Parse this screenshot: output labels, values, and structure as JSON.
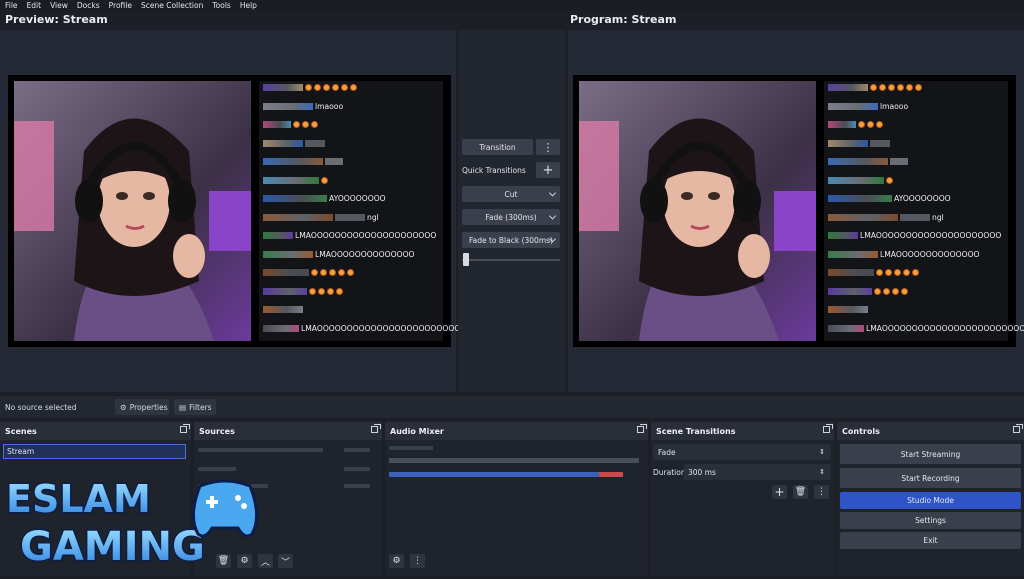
{
  "menu": [
    "File",
    "Edit",
    "View",
    "Docks",
    "Profile",
    "Scene Collection",
    "Tools",
    "Help"
  ],
  "preview": {
    "title": "Preview: Stream"
  },
  "program": {
    "title": "Program: Stream"
  },
  "chat": {
    "lines": [
      {
        "text": "",
        "emojis": 6
      },
      {
        "text": "lmaooo",
        "emojis": 0
      },
      {
        "text": "",
        "emojis": 3
      },
      {
        "text": "",
        "emojis": 0
      },
      {
        "text": "",
        "emojis": 0
      },
      {
        "text": "",
        "emojis": 1
      },
      {
        "text": "AYOOOOOOOO",
        "emojis": 0
      },
      {
        "text": "ngl",
        "emojis": 0
      },
      {
        "text": "LMAOOOOOOOOOOOOOOOOOOOOO",
        "emojis": 0
      },
      {
        "text": "LMAOOOOOOOOOOOOOO",
        "emojis": 0
      },
      {
        "text": "",
        "emojis": 5
      },
      {
        "text": "",
        "emojis": 4
      },
      {
        "text": "",
        "emojis": 0
      },
      {
        "text": "LMAOOOOOOOOOOOOOOOOOOOOOOOOOOOO",
        "emojis": 0
      }
    ]
  },
  "transitions": {
    "transition_label": "Transition",
    "quick_label": "Quick Transitions",
    "cut_label": "Cut",
    "fade_label": "Fade (300ms)",
    "fade_black_label": "Fade to Black (300ms)"
  },
  "infobar": {
    "status": "No source selected",
    "properties": "Properties",
    "filters": "Filters"
  },
  "docks": {
    "scenes": {
      "title": "Scenes",
      "items": [
        "Stream"
      ]
    },
    "sources": {
      "title": "Sources"
    },
    "mixer": {
      "title": "Audio Mixer"
    },
    "scene_transitions": {
      "title": "Scene Transitions",
      "selected": "Fade",
      "duration_label": "Duration",
      "duration_value": "300 ms"
    },
    "controls": {
      "title": "Controls",
      "start_streaming": "Start Streaming",
      "start_recording": "Start Recording",
      "studio_mode": "Studio Mode",
      "settings": "Settings",
      "exit": "Exit"
    }
  },
  "logo": {
    "line1": "ESLAM",
    "line2": "GAMING"
  },
  "colors": {
    "accent": "#2f54c7",
    "background": "#1c1f26",
    "panel": "#1f232b",
    "button": "#3a3f4b"
  }
}
